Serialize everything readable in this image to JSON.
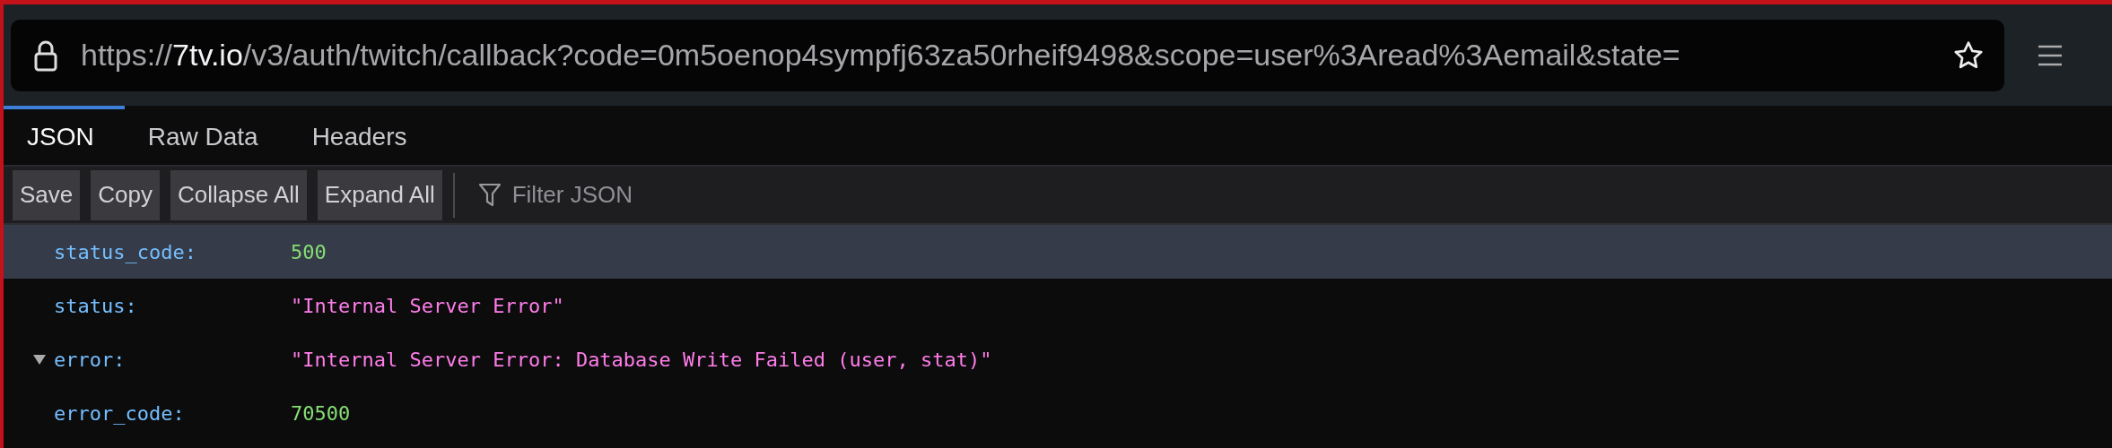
{
  "address_bar": {
    "scheme": "https://",
    "domain": "7tv.io",
    "path": "/v3/auth/twitch/callback?code=0m5oenop4sympfj63za50rheif9498&scope=user%3Aread%3Aemail&state="
  },
  "tabs": [
    {
      "label": "JSON",
      "selected": true
    },
    {
      "label": "Raw Data",
      "selected": false
    },
    {
      "label": "Headers",
      "selected": false
    }
  ],
  "toolbar": {
    "buttons": [
      "Save",
      "Copy",
      "Collapse All",
      "Expand All"
    ],
    "filter": {
      "placeholder": "Filter JSON"
    }
  },
  "rows": [
    {
      "key": "status_code:",
      "value": "500",
      "kind": "number",
      "selected": true
    },
    {
      "key": "status:",
      "value": "\"Internal Server Error\"",
      "kind": "string",
      "selected": false
    },
    {
      "key": "error:",
      "value": "\"Internal Server Error: Database Write Failed (user, stat)\"",
      "kind": "string",
      "selected": false,
      "expanded": true
    },
    {
      "key": "error_code:",
      "value": "70500",
      "kind": "number",
      "selected": false
    }
  ]
}
